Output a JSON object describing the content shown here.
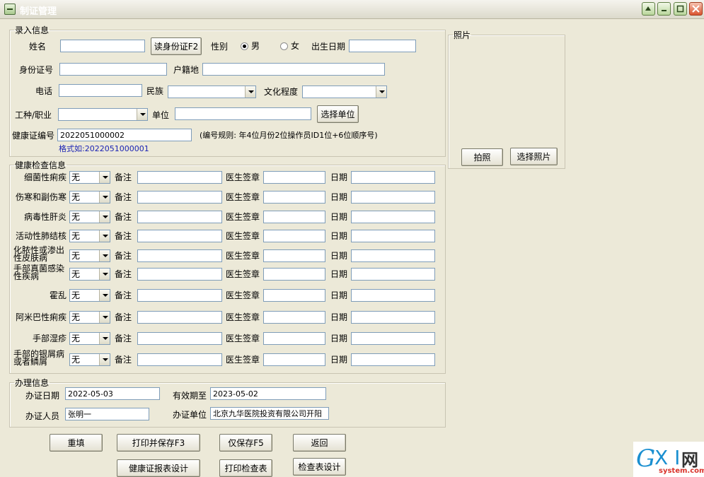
{
  "window": {
    "title": "制证管理"
  },
  "entry": {
    "legend": "录入信息",
    "name_label": "姓名",
    "name_value": "",
    "read_id_button": "读身份证F2",
    "gender_label": "性别",
    "male": "男",
    "female": "女",
    "birth_label": "出生日期",
    "birth_value": "",
    "id_label": "身份证号",
    "id_value": "",
    "hukou_label": "户籍地",
    "hukou_value": "",
    "phone_label": "电话",
    "phone_value": "",
    "ethnic_label": "民族",
    "ethnic_value": "",
    "edu_label": "文化程度",
    "edu_value": "",
    "job_label": "工种/职业",
    "job_value": "",
    "unit_label": "单位",
    "unit_value": "",
    "select_unit_button": "选择单位",
    "cert_no_label": "健康证编号",
    "cert_no_value": "2022051000002",
    "cert_rule": "(编号规则: 年4位月份2位操作员ID1位+6位顺序号)",
    "format_hint": "格式如:2022051000001"
  },
  "photo": {
    "legend": "照片",
    "capture_button": "拍照",
    "select_button": "选择照片"
  },
  "health": {
    "legend": "健康检查信息",
    "note_label": "备注",
    "doctor_label": "医生签章",
    "date_label": "日期",
    "rows": [
      {
        "name": "细菌性痢疾",
        "value": "无"
      },
      {
        "name": "伤寒和副伤寒",
        "value": "无"
      },
      {
        "name": "病毒性肝炎",
        "value": "无"
      },
      {
        "name": "活动性肺结核",
        "value": "无"
      },
      {
        "name": "化脓性或渗出性皮肤病",
        "value": "无"
      },
      {
        "name": "手部真菌感染性疾病",
        "value": "无"
      },
      {
        "name": "霍乱",
        "value": "无"
      },
      {
        "name": "阿米巴性痢疾",
        "value": "无"
      },
      {
        "name": "手部湿疹",
        "value": "无"
      },
      {
        "name": "手部的银屑病或者鳞屑",
        "value": "无"
      }
    ]
  },
  "process": {
    "legend": "办理信息",
    "issue_date_label": "办证日期",
    "issue_date_value": "2022-05-03",
    "valid_until_label": "有效期至",
    "valid_until_value": "2023-05-02",
    "staff_label": "办证人员",
    "staff_value": "张明一",
    "org_label": "办证单位",
    "org_value": "北京九华医院投资有限公司开阳"
  },
  "actions": {
    "reset": "重填",
    "print_save": "打印并保存F3",
    "save_only": "仅保存F5",
    "back": "返回",
    "cert_design": "健康证报表设计",
    "print_check": "打印检查表",
    "check_design": "检查表设计"
  },
  "watermark": {
    "g": "G",
    "xi": "X I",
    "net": "网",
    "site": "system.com"
  }
}
